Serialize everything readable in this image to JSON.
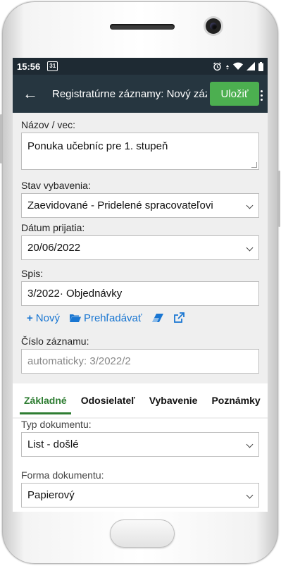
{
  "statusbar": {
    "time": "15:56",
    "calendar_day": "31"
  },
  "appbar": {
    "back_label": "←",
    "title": "Registratúrne záznamy: Nový záznam",
    "save_label": "Uložiť"
  },
  "form": {
    "name": {
      "label": "Názov / vec:",
      "value": "Ponuka učebníc pre 1. stupeň"
    },
    "state": {
      "label": "Stav vybavenia:",
      "value": "Zaevidované - Pridelené spracovateľovi"
    },
    "date": {
      "label": "Dátum prijatia:",
      "value": "20/06/2022"
    },
    "file": {
      "label": "Spis:",
      "value": "3/2022· Objednávky"
    },
    "actions": {
      "new_label": "Nový",
      "browse_label": "Prehľadávať"
    },
    "number": {
      "label": "Číslo záznamu:",
      "placeholder": "automaticky: 3/2022/2"
    }
  },
  "tabs": [
    "Základné",
    "Odosielateľ",
    "Vybavenie",
    "Poznámky"
  ],
  "lower": {
    "doc_type": {
      "label": "Typ dokumentu:",
      "value": "List - došlé"
    },
    "doc_form": {
      "label": "Forma dokumentu:",
      "value": "Papierový"
    }
  },
  "colors": {
    "appbar": "#263640",
    "statusbar": "#1e2a33",
    "save": "#4caf50",
    "accent": "#1976d2",
    "tab_active": "#2e7d32"
  }
}
